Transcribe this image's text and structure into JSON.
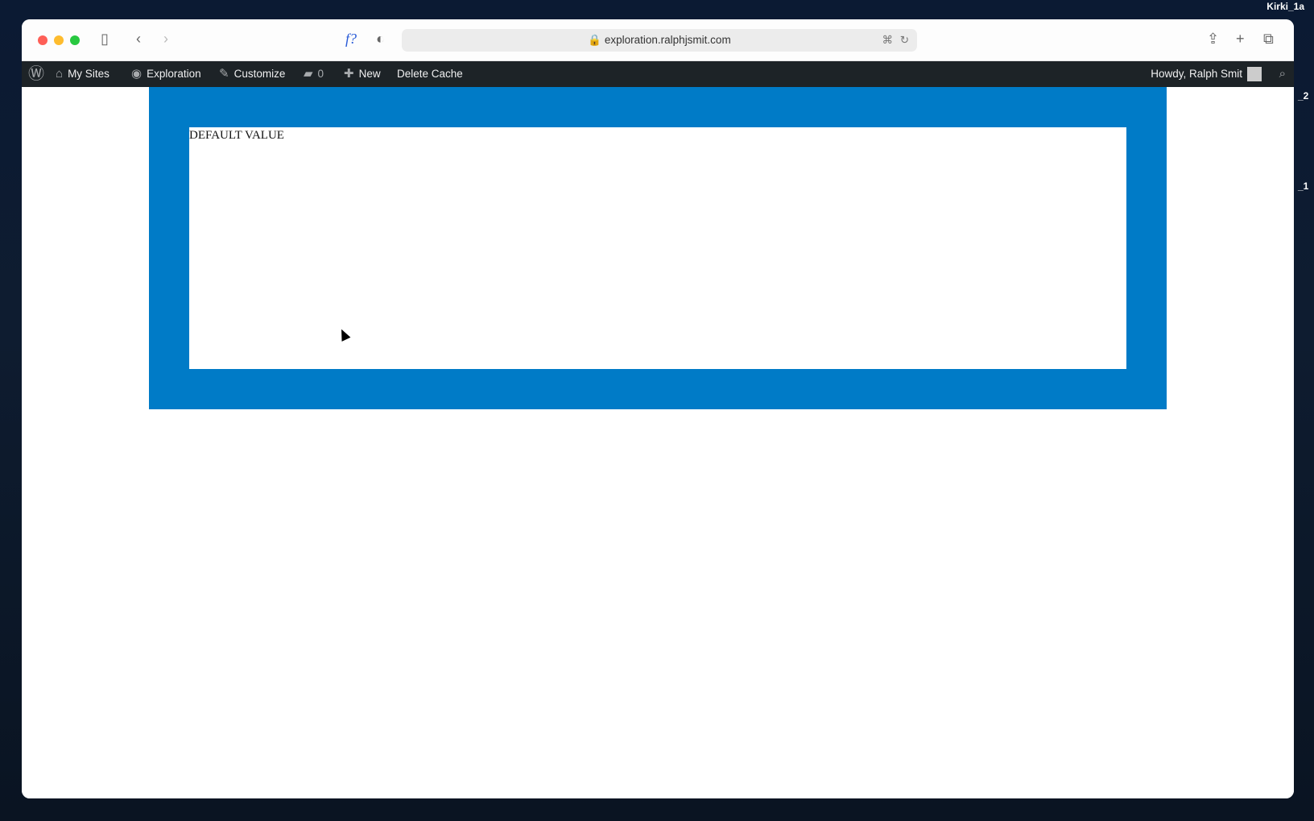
{
  "desktop": {
    "labels": [
      "Kirki_1a",
      "_2",
      "_1"
    ]
  },
  "browser": {
    "url": "exploration.ralphjsmit.com",
    "extension_label": "f?"
  },
  "adminbar": {
    "my_sites": "My Sites",
    "site": "Exploration",
    "customize": "Customize",
    "comments_count": "0",
    "new": "New",
    "delete_cache": "Delete Cache",
    "howdy": "Howdy, Ralph Smit"
  },
  "page": {
    "field_value": "DEFAULT VALUE",
    "accent_color": "#007bc7"
  }
}
